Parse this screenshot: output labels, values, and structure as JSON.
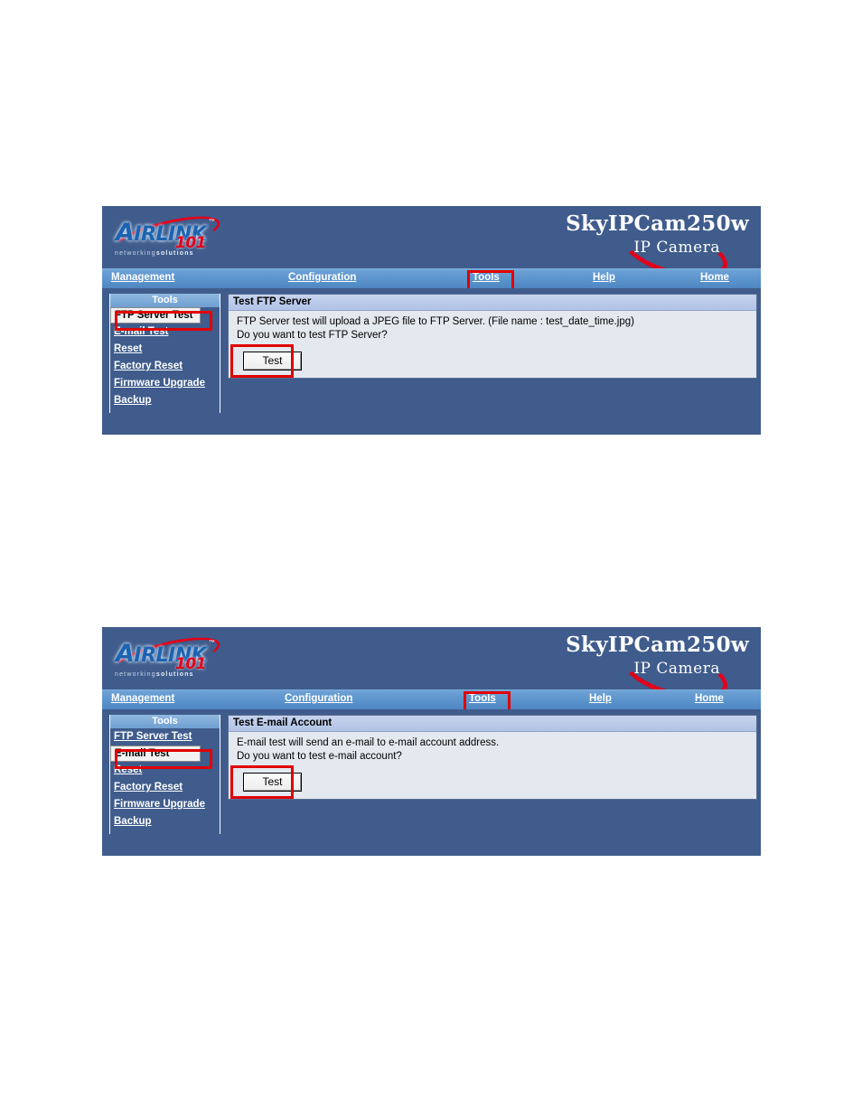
{
  "brand": {
    "logo_word_a": "A",
    "logo_word_rest": "IRLINK",
    "logo_tm": "™",
    "logo_101": "101",
    "logo_tagline_light": "networking",
    "logo_tagline_bold": "solutions",
    "product_name": "SkyIPCam250w",
    "product_sub": "IP Camera"
  },
  "nav": {
    "items": [
      {
        "label": "Management",
        "highlighted": false
      },
      {
        "label": "Configuration",
        "highlighted": false
      },
      {
        "label": "Tools",
        "highlighted": true
      },
      {
        "label": "Help",
        "highlighted": false
      },
      {
        "label": "Home",
        "highlighted": false
      }
    ]
  },
  "sidebar": {
    "title": "Tools",
    "items": [
      {
        "label": "FTP Server Test"
      },
      {
        "label": "E-mail Test"
      },
      {
        "label": "Reset"
      },
      {
        "label": "Factory Reset"
      },
      {
        "label": "Firmware Upgrade"
      },
      {
        "label": "Backup"
      }
    ]
  },
  "screenshot_1": {
    "selected_sidebar_item": "FTP Server Test",
    "panel": {
      "title": "Test FTP Server",
      "line1": "FTP Server test will upload a JPEG file to FTP Server. (File name : test_date_time.jpg)",
      "line2": "Do you want to test FTP Server?",
      "button_label": "Test"
    }
  },
  "screenshot_2": {
    "selected_sidebar_item": "E-mail Test",
    "panel": {
      "title": "Test E-mail Account",
      "line1": "E-mail test will send an e-mail to e-mail account address.",
      "line2": "Do you want to test e-mail account?",
      "button_label": "Test"
    }
  },
  "colors": {
    "header_blue": "#3f5c8c",
    "nav_blue": "#5b93cc",
    "panel_header": "#b8c8ea",
    "panel_body": "#e4e8ef",
    "annotation_red": "#e10000",
    "logo_blue": "#1c63b0",
    "logo_red": "#e2001a"
  }
}
